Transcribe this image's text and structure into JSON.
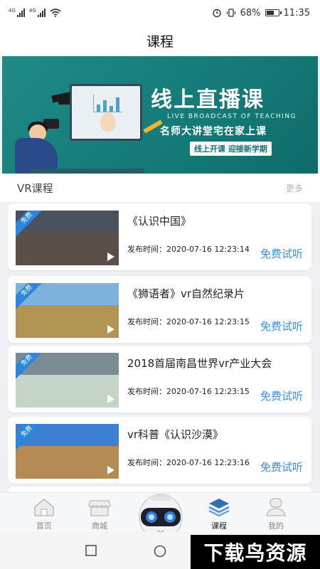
{
  "status_bar": {
    "sim1": "4G",
    "sim2": "4G",
    "battery": "68%",
    "battery_level": 0.68,
    "time": "11:35",
    "icons": [
      "signal-icon",
      "signal-icon",
      "wifi-icon",
      "alarm-icon",
      "vibrate-icon",
      "battery-icon"
    ]
  },
  "header": {
    "title": "课程"
  },
  "banner": {
    "title": "线上直播课",
    "subtitle": "LIVE BROADCAST OF TEACHING",
    "chars": "名师大讲堂宅在家上课",
    "pill": "线上开课 迎接新学期"
  },
  "section": {
    "title": "VR课程",
    "more": "更多"
  },
  "courses": [
    {
      "badge": "免费",
      "title": "《认识中国》",
      "time": "发布时间：2020-07-16 12:23:14",
      "action": "免费试听",
      "sky": "#4a5260",
      "ground": "#5a5048"
    },
    {
      "badge": "免费",
      "title": "《狮语者》vr自然纪录片",
      "time": "发布时间：2020-07-16 12:23:15",
      "action": "免费试听",
      "sky": "#7eb3e0",
      "ground": "#b39553"
    },
    {
      "badge": "免费",
      "title": "2018首届南昌世界vr产业大会",
      "time": "发布时间：2020-07-16 12:23:15",
      "action": "免费试听",
      "sky": "#7c8c94",
      "ground": "#c4d4c7"
    },
    {
      "badge": "免费",
      "title": "vr科普《认识沙漠》",
      "time": "发布时间：2020-07-16 12:23:16",
      "action": "免费试听",
      "sky": "#3d7fd0",
      "ground": "#b48a55"
    }
  ],
  "tabbar": {
    "items": [
      {
        "label": "首页",
        "icon": "home-icon"
      },
      {
        "label": "商城",
        "icon": "store-icon"
      },
      {
        "label": "课程",
        "icon": "layers-icon",
        "active": true
      },
      {
        "label": "我的",
        "icon": "profile-icon"
      }
    ]
  },
  "watermark": "下载鸟资源"
}
